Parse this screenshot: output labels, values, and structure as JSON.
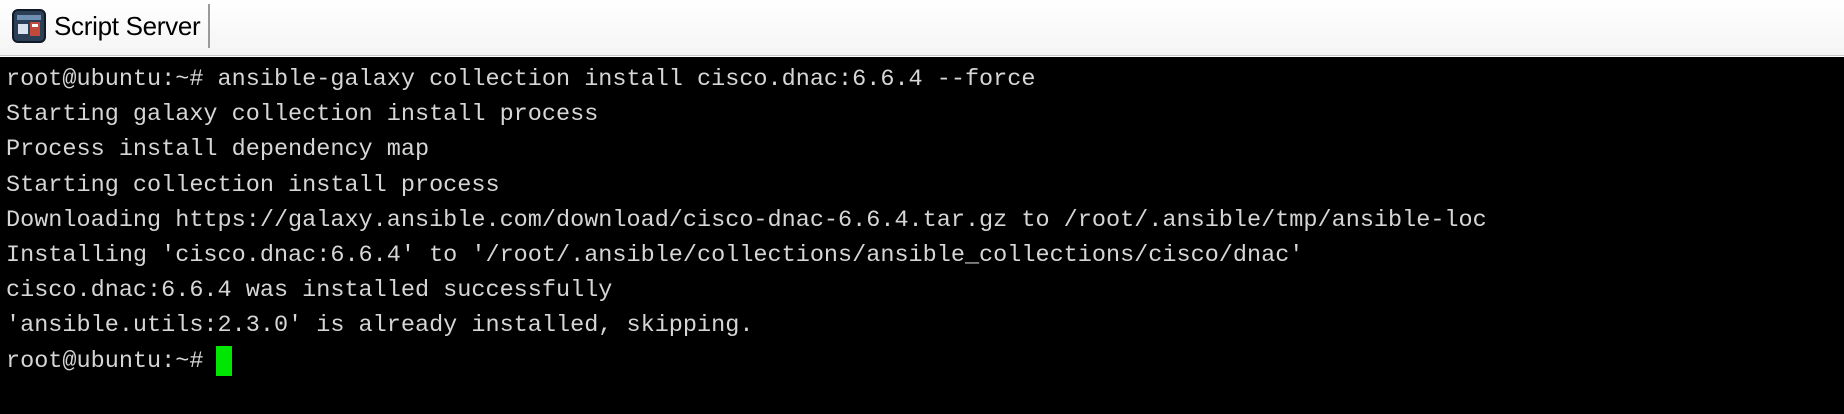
{
  "window": {
    "title": "Script Server",
    "icon": "terminal-app-icon"
  },
  "terminal": {
    "text_color": "#d6d6d6",
    "background": "#000000",
    "cursor_color": "#00e600",
    "lines": [
      "root@ubuntu:~# ansible-galaxy collection install cisco.dnac:6.6.4 --force",
      "Starting galaxy collection install process",
      "Process install dependency map",
      "Starting collection install process",
      "Downloading https://galaxy.ansible.com/download/cisco-dnac-6.6.4.tar.gz to /root/.ansible/tmp/ansible-loc",
      "Installing 'cisco.dnac:6.6.4' to '/root/.ansible/collections/ansible_collections/cisco/dnac'",
      "cisco.dnac:6.6.4 was installed successfully",
      "'ansible.utils:2.3.0' is already installed, skipping."
    ],
    "prompt": "root@ubuntu:~#"
  }
}
